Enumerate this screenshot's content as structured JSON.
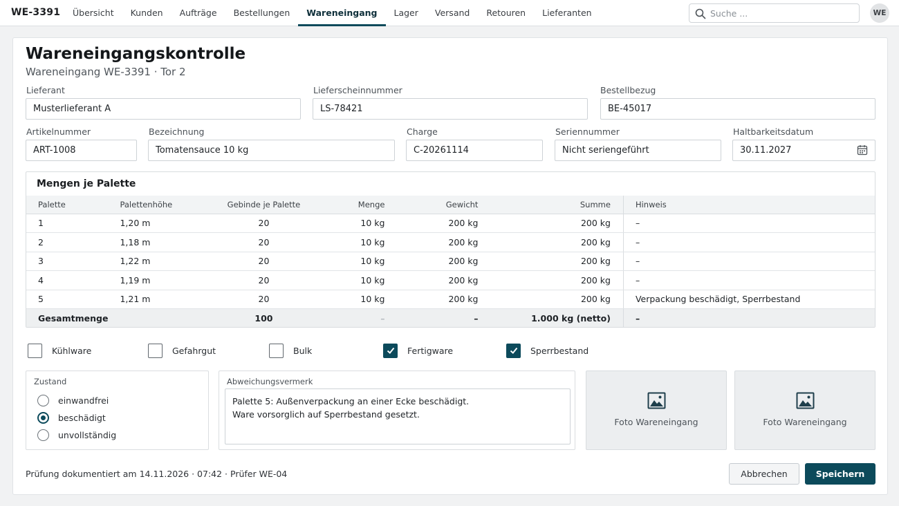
{
  "app": {
    "id": "WE-3391",
    "avatar_initials": "WE"
  },
  "nav": {
    "items": [
      "Übersicht",
      "Kunden",
      "Aufträge",
      "Bestellungen",
      "Wareneingang",
      "Lager",
      "Versand",
      "Retouren",
      "Lieferanten"
    ],
    "active": "Wareneingang"
  },
  "search": {
    "placeholder": "Suche ...",
    "icon": "search-icon"
  },
  "page": {
    "title": "Wareneingangskontrolle",
    "subtitle": "Wareneingang WE-3391 · Tor 2"
  },
  "fields": {
    "lieferant": {
      "label": "Lieferant",
      "value": "Musterlieferant A"
    },
    "lieferscheinnummer": {
      "label": "Lieferscheinnummer",
      "value": "LS-78421"
    },
    "bestellbezug": {
      "label": "Bestellbezug",
      "value": "BE-45017"
    },
    "artikelnummer": {
      "label": "Artikelnummer",
      "value": "ART-1008"
    },
    "bezeichnung": {
      "label": "Bezeichnung",
      "value": "Tomatensauce 10 kg"
    },
    "charge": {
      "label": "Charge",
      "value": "C-20261114"
    },
    "seriennummer": {
      "label": "Seriennummer",
      "value": "Nicht seriengeführt"
    },
    "haltbarkeitsdatum": {
      "label": "Haltbarkeitsdatum",
      "value": "30.11.2027",
      "icon": "calendar-icon"
    }
  },
  "table": {
    "title": "Mengen je Palette",
    "headers": [
      "Palette",
      "Palettenhöhe",
      "Gebinde je Palette",
      "Menge",
      "Gewicht",
      "Summe",
      "Hinweis"
    ],
    "rows": [
      [
        "1",
        "1,20 m",
        "20",
        "10 kg",
        "200 kg",
        "200 kg",
        "–"
      ],
      [
        "2",
        "1,18 m",
        "20",
        "10 kg",
        "200 kg",
        "200 kg",
        "–"
      ],
      [
        "3",
        "1,22 m",
        "20",
        "10 kg",
        "200 kg",
        "200 kg",
        "–"
      ],
      [
        "4",
        "1,19 m",
        "20",
        "10 kg",
        "200 kg",
        "200 kg",
        "–"
      ],
      [
        "5",
        "1,21 m",
        "20",
        "10 kg",
        "200 kg",
        "200 kg",
        "Verpackung beschädigt, Sperrbestand"
      ]
    ],
    "total": [
      "Gesamtmenge",
      "",
      "100",
      "–",
      "–",
      "1.000 kg (netto)",
      "–"
    ]
  },
  "checkboxes": [
    {
      "label": "Kühlware",
      "checked": false
    },
    {
      "label": "Gefahrgut",
      "checked": false
    },
    {
      "label": "Bulk",
      "checked": false
    },
    {
      "label": "Fertigware",
      "checked": true
    },
    {
      "label": "Sperrbestand",
      "checked": true
    }
  ],
  "zustand": {
    "label": "Zustand",
    "options": [
      {
        "label": "einwandfrei",
        "selected": false
      },
      {
        "label": "beschädigt",
        "selected": true
      },
      {
        "label": "unvollständig",
        "selected": false
      }
    ]
  },
  "abweichung": {
    "label": "Abweichungsvermerk",
    "text": "Palette 5: Außenverpackung an einer Ecke beschädigt.\nWare vorsorglich auf Sperrbestand gesetzt."
  },
  "photos": [
    {
      "label": "Foto Wareneingang",
      "icon": "image-icon"
    },
    {
      "label": "Foto Wareneingang",
      "icon": "image-icon"
    }
  ],
  "footer": {
    "status": "Prüfung dokumentiert am 14.11.2026 · 07:42 · Prüfer WE-04",
    "cancel_label": "Abbrechen",
    "save_label": "Speichern"
  },
  "colors": {
    "accent": "#0c4a5b"
  }
}
